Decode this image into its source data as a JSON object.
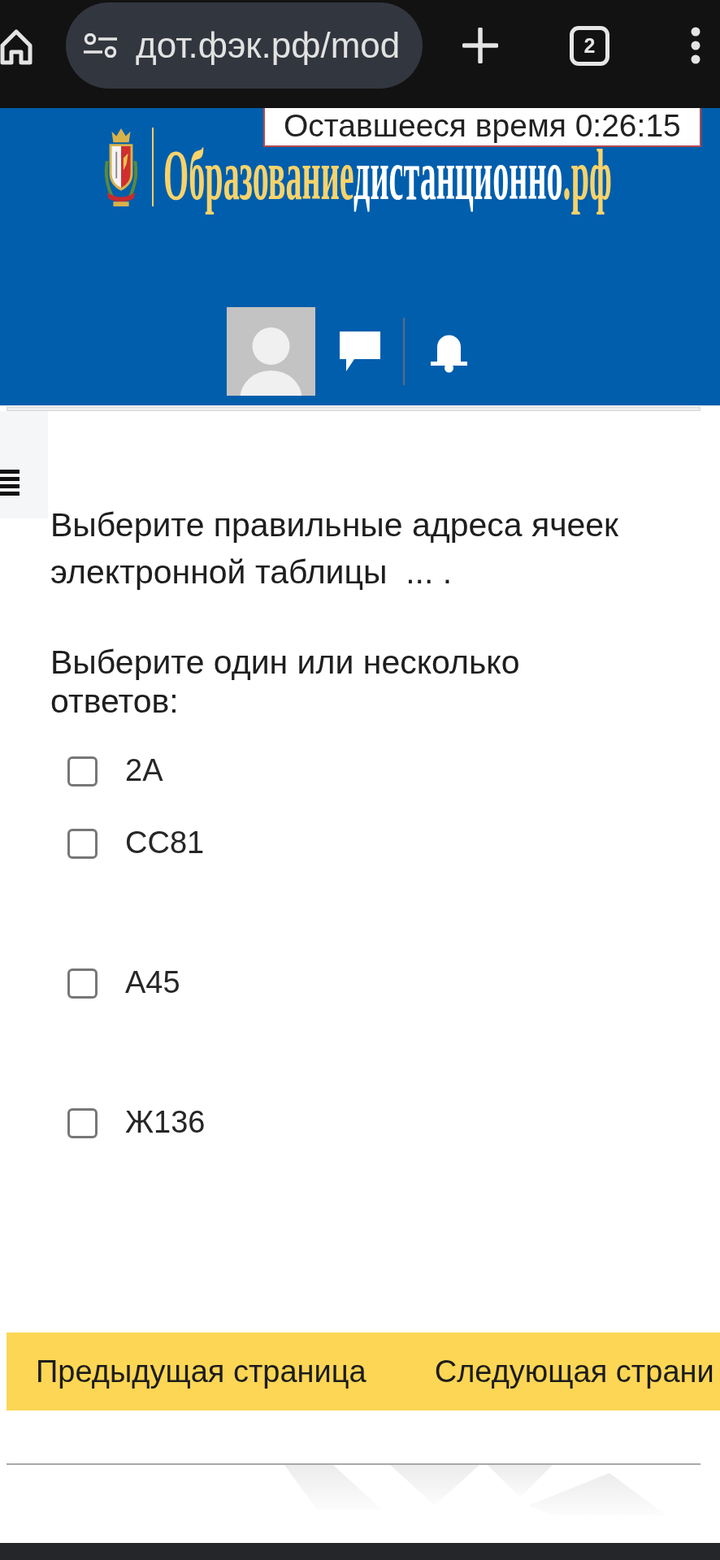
{
  "browser": {
    "url": "дот.фэк.рф/mod",
    "tab_count": "2"
  },
  "header": {
    "timer": "Оставшееся время 0:26:15",
    "logo_parts": [
      "Образование",
      "дистанционно",
      ".рф"
    ]
  },
  "question": {
    "text": "Выберите правильные адреса ячеек электронной таблицы  ... .",
    "prompt": "Выберите один или несколько ответов:",
    "options": [
      {
        "label": "2A",
        "checked": false
      },
      {
        "label": "CC81",
        "checked": false
      },
      {
        "label": "A45",
        "checked": false
      },
      {
        "label": "Ж136",
        "checked": false
      }
    ]
  },
  "navigation": {
    "buttons": [
      "Предыдущая страница",
      "Следующая страни"
    ]
  }
}
